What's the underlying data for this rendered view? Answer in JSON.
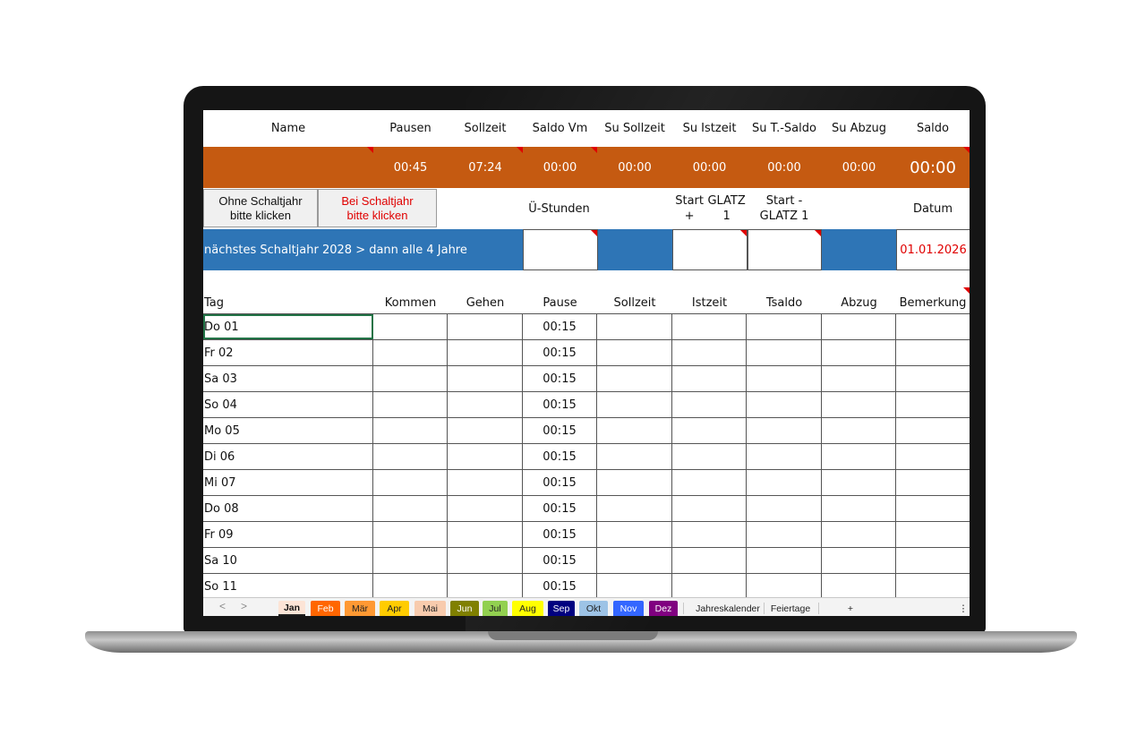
{
  "header": {
    "name": "Name",
    "pausen": "Pausen",
    "sollzeit": "Sollzeit",
    "saldo_vm": "Saldo Vm",
    "su_sollzeit": "Su Sollzeit",
    "su_istzeit": "Su Istzeit",
    "su_tsaldo": "Su T.-Saldo",
    "su_abzug": "Su Abzug",
    "saldo": "Saldo"
  },
  "summary": {
    "pausen": "00:45",
    "sollzeit": "07:24",
    "saldo_vm": "00:00",
    "su_sollzeit": "00:00",
    "su_istzeit": "00:00",
    "su_tsaldo": "00:00",
    "su_abzug": "00:00",
    "saldo": "00:00"
  },
  "buttons": {
    "ohne_line1": "Ohne Schaltjahr",
    "ohne_line2": "bitte klicken",
    "bei_line1": "Bei Schaltjahr",
    "bei_line2": "bitte klicken"
  },
  "labels": {
    "ue_stunden": "Ü-Stunden",
    "start_plus_l1": "Start +",
    "start_plus_l2": "GLATZ 1",
    "start_minus_l1": "Start -",
    "start_minus_l2": "GLATZ 1",
    "datum": "Datum"
  },
  "info": {
    "leap_year_text": "nächstes Schaltjahr 2028 > dann alle 4 Jahre",
    "date": "01.01.2026"
  },
  "table": {
    "columns": [
      "Tag",
      "Kommen",
      "Gehen",
      "Pause",
      "Sollzeit",
      "Istzeit",
      "Tsaldo",
      "Abzug",
      "Bemerkung"
    ],
    "rows": [
      {
        "tag": "Do 01",
        "pause": "00:15"
      },
      {
        "tag": "Fr 02",
        "pause": "00:15"
      },
      {
        "tag": "Sa 03",
        "pause": "00:15"
      },
      {
        "tag": "So 04",
        "pause": "00:15"
      },
      {
        "tag": "Mo 05",
        "pause": "00:15"
      },
      {
        "tag": "Di 06",
        "pause": "00:15"
      },
      {
        "tag": "Mi 07",
        "pause": "00:15"
      },
      {
        "tag": "Do 08",
        "pause": "00:15"
      },
      {
        "tag": "Fr 09",
        "pause": "00:15"
      },
      {
        "tag": "Sa 10",
        "pause": "00:15"
      },
      {
        "tag": "So 11",
        "pause": "00:15"
      }
    ]
  },
  "sheet_tabs": {
    "nav_prev": "<",
    "nav_next": ">",
    "months": [
      {
        "label": "Jan",
        "color": "#fce4d6",
        "text": "#111111"
      },
      {
        "label": "Feb",
        "color": "#ff6600",
        "text": "#ffffff"
      },
      {
        "label": "Mär",
        "color": "#ff9933",
        "text": "#222222"
      },
      {
        "label": "Apr",
        "color": "#ffcc00",
        "text": "#222222"
      },
      {
        "label": "Mai",
        "color": "#f8cbad",
        "text": "#222222"
      },
      {
        "label": "Jun",
        "color": "#808000",
        "text": "#ffffff"
      },
      {
        "label": "Jul",
        "color": "#92d050",
        "text": "#222222"
      },
      {
        "label": "Aug",
        "color": "#ffff00",
        "text": "#222222"
      },
      {
        "label": "Sep",
        "color": "#000080",
        "text": "#ffffff"
      },
      {
        "label": "Okt",
        "color": "#9dc3e6",
        "text": "#222222"
      },
      {
        "label": "Nov",
        "color": "#3366ff",
        "text": "#ffffff"
      },
      {
        "label": "Dez",
        "color": "#800080",
        "text": "#ffffff"
      }
    ],
    "jahreskalender": "Jahreskalender",
    "feiertage": "Feiertage",
    "add": "+",
    "more": "⋮"
  },
  "colors": {
    "orange": "#c55a11",
    "blue": "#2e75b6",
    "red_text": "#e00000",
    "selection": "#217346"
  }
}
